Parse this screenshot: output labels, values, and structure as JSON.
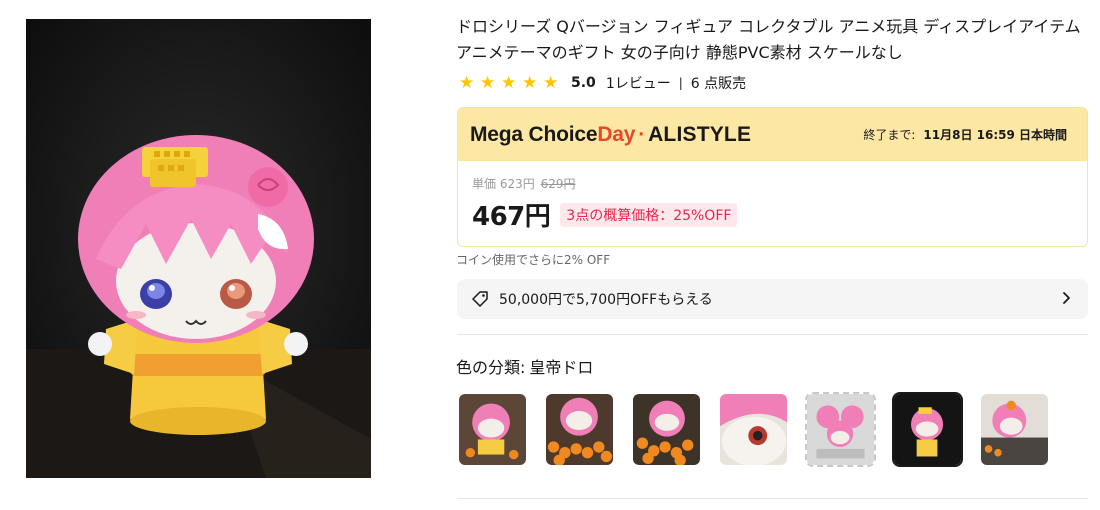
{
  "product": {
    "title": "ドロシリーズ Qバージョン フィギュア コレクタブル アニメ玩具 ディスプレイアイテム アニメテーマのギフト 女の子向け 静態PVC素材 スケールなし",
    "rating": {
      "stars": 5,
      "score": "5.0",
      "reviews_label": "1レビュー",
      "separator": "|",
      "sold_label": "6 点販売"
    }
  },
  "promo": {
    "mega_label": "Mega Choice",
    "day_label": "Day",
    "dot": "·",
    "brand": "ALISTYLE",
    "countdown_label": "終了まで:",
    "countdown_time": "11月8日 16:59 日本時間"
  },
  "price": {
    "unit_label": "単価 623円",
    "unit_original": "629円",
    "current": "467円",
    "bundle_tag": "3点の概算価格：25%OFF"
  },
  "coin_line": "コイン使用でさらに2% OFF",
  "coupon": {
    "text": "50,000円で5,700円OFFもらえる"
  },
  "variant": {
    "label": "色の分類:",
    "value": "皇帝ドロ",
    "thumbnails": [
      {
        "name": "variant-1"
      },
      {
        "name": "variant-2"
      },
      {
        "name": "variant-3"
      },
      {
        "name": "variant-4"
      },
      {
        "name": "variant-5"
      },
      {
        "name": "variant-6"
      },
      {
        "name": "variant-7"
      }
    ],
    "selected_index": 5
  },
  "colors": {
    "accent_red": "#e9462c",
    "star_yellow": "#fdc600",
    "promo_bg": "#fde7a4",
    "bundle_text": "#e8264d"
  }
}
